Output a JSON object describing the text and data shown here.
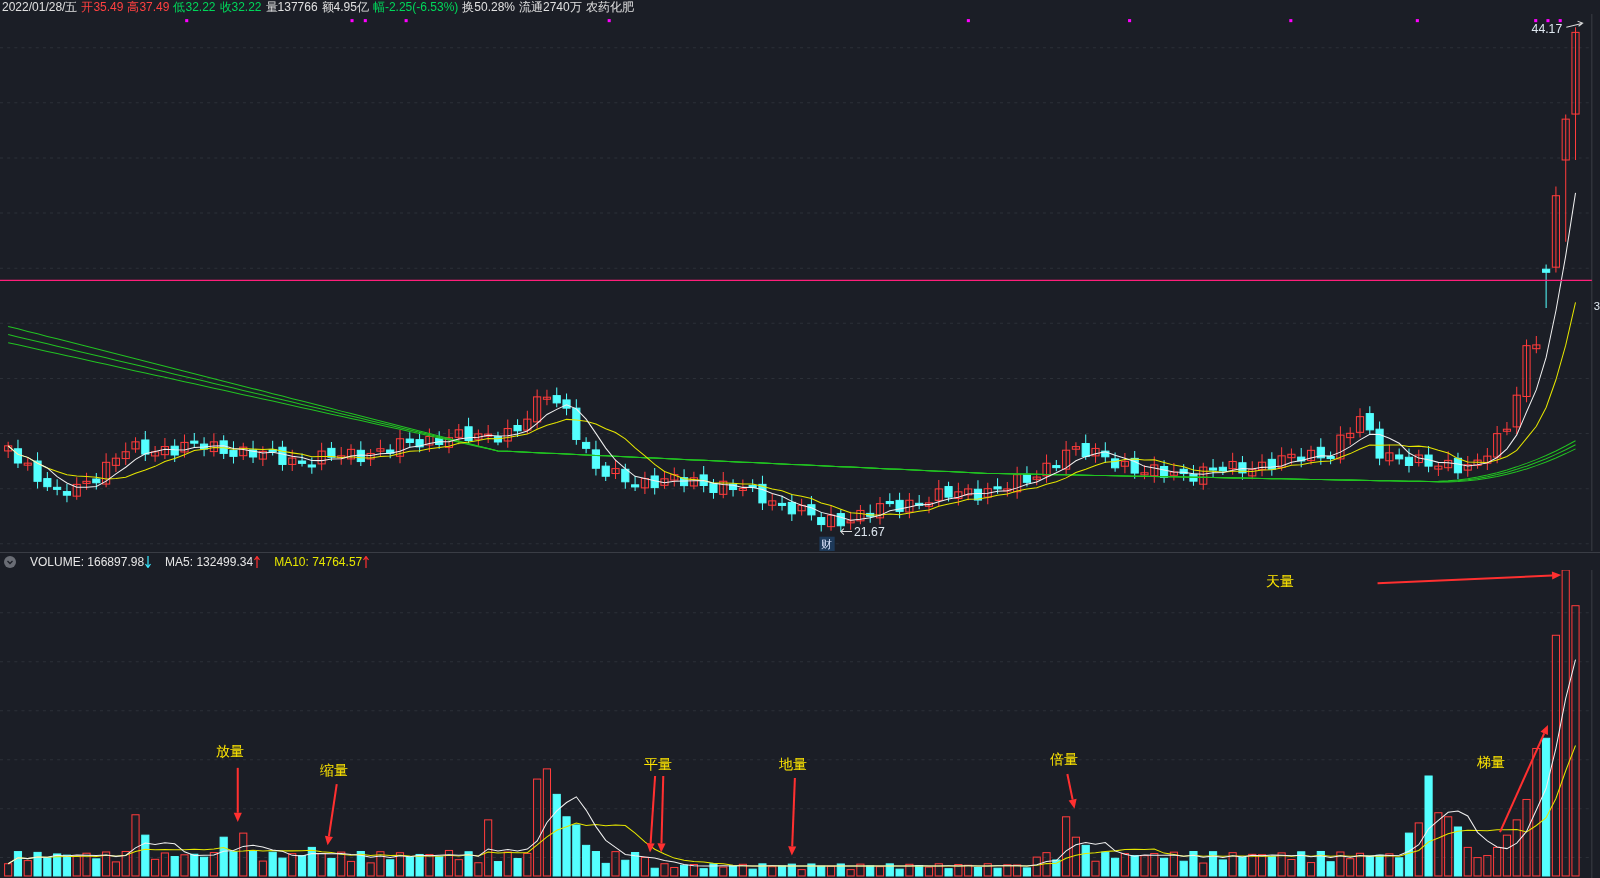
{
  "header": {
    "date": "2022/01/28/五",
    "fields": [
      {
        "text": "开35.49",
        "color": "#ff4040"
      },
      {
        "text": "高37.49",
        "color": "#ff4040"
      },
      {
        "text": "低32.22",
        "color": "#00d65a"
      },
      {
        "text": "收32.22",
        "color": "#00d65a"
      },
      {
        "text": "量137766",
        "color": "#e0e0e0"
      },
      {
        "text": "额4.95亿",
        "color": "#e0e0e0"
      },
      {
        "text": "幅-2.25(-6.53%)",
        "color": "#00d65a"
      },
      {
        "text": "换50.28%",
        "color": "#e0e0e0"
      },
      {
        "text": "流通2740万",
        "color": "#e0e0e0"
      },
      {
        "text": "农药化肥",
        "color": "#e0e0e0"
      }
    ]
  },
  "price_chart": {
    "high_label": "44.17",
    "low_label": "21.67",
    "event_marker": "财",
    "axis_label": "3"
  },
  "volume_panel": {
    "indicators": [
      {
        "label": "VOLUME: 166897.98",
        "rising": false,
        "color": "#e6e6e6"
      },
      {
        "label": "MA5: 132499.34",
        "rising": true,
        "color": "#e6e6e6"
      },
      {
        "label": "MA10: 74764.57",
        "rising": true,
        "color": "#e6e600"
      }
    ],
    "annotations": [
      {
        "text": "天量"
      },
      {
        "text": "放量"
      },
      {
        "text": "缩量"
      },
      {
        "text": "平量"
      },
      {
        "text": "地量"
      },
      {
        "text": "倍量"
      },
      {
        "text": "梯量"
      }
    ]
  }
}
